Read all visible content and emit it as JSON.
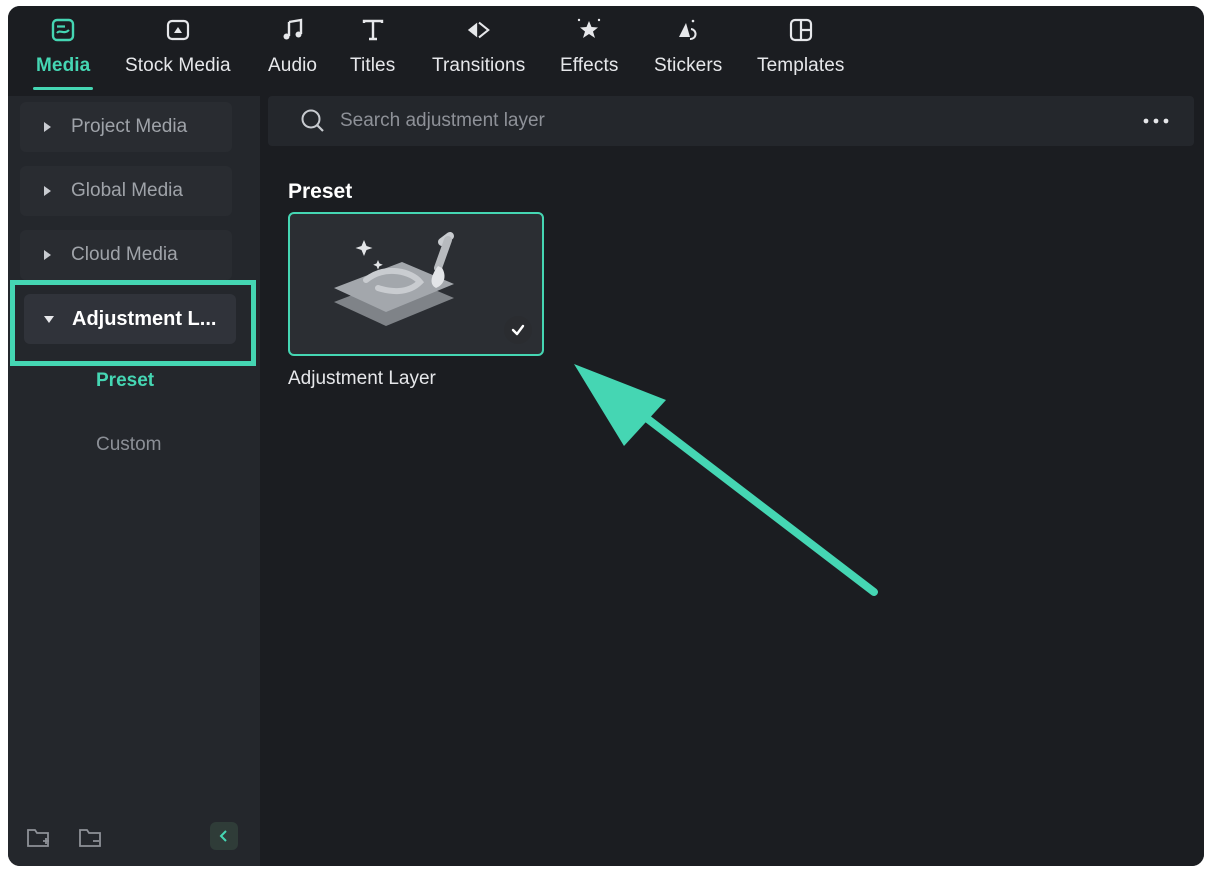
{
  "tabs": [
    {
      "label": "Media",
      "icon": "media-icon",
      "active": true
    },
    {
      "label": "Stock Media",
      "icon": "stock-media-icon"
    },
    {
      "label": "Audio",
      "icon": "music-note-icon"
    },
    {
      "label": "Titles",
      "icon": "text-t-icon"
    },
    {
      "label": "Transitions",
      "icon": "transitions-icon"
    },
    {
      "label": "Effects",
      "icon": "effects-star-icon"
    },
    {
      "label": "Stickers",
      "icon": "stickers-icon"
    },
    {
      "label": "Templates",
      "icon": "templates-icon"
    }
  ],
  "sidebar": {
    "items": [
      {
        "label": "Project Media"
      },
      {
        "label": "Global Media"
      },
      {
        "label": "Cloud Media"
      },
      {
        "label": "Adjustment L...",
        "expanded": true
      }
    ],
    "subitems": [
      {
        "label": "Preset",
        "active": true
      },
      {
        "label": "Custom"
      }
    ]
  },
  "search": {
    "placeholder": "Search adjustment layer",
    "value": ""
  },
  "main": {
    "section_title": "Preset",
    "card": {
      "label": "Adjustment Layer",
      "selected": true
    }
  },
  "colors": {
    "accent": "#45d6b3",
    "background": "#1b1d21",
    "sidebar": "#24272c"
  }
}
